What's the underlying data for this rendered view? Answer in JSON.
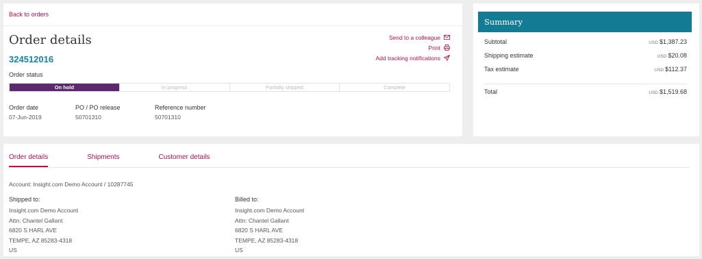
{
  "order": {
    "back_link": "Back to orders",
    "title": "Order details",
    "number": "324512016",
    "status_label": "Order status",
    "actions": [
      {
        "label": "Send to a colleague",
        "icon": "mail-icon"
      },
      {
        "label": "Print",
        "icon": "print-icon"
      },
      {
        "label": "Add tracking notifications",
        "icon": "send-icon"
      }
    ],
    "status_steps": [
      {
        "label": "On hold",
        "active": true
      },
      {
        "label": "In progress",
        "active": false
      },
      {
        "label": "Partially shipped",
        "active": false
      },
      {
        "label": "Complete",
        "active": false
      }
    ],
    "meta": {
      "order_date_label": "Order date",
      "order_date": "07-Jun-2019",
      "po_label": "PO / PO release",
      "po": "50701310",
      "ref_label": "Reference number",
      "ref": "50701310"
    }
  },
  "summary": {
    "title": "Summary",
    "currency": "USD",
    "rows": [
      {
        "label": "Subtotal",
        "amount": "$1,387.23"
      },
      {
        "label": "Shipping estimate",
        "amount": "$20.08"
      },
      {
        "label": "Tax estimate",
        "amount": "$112.37"
      }
    ],
    "total_label": "Total",
    "total_amount": "$1,519.68"
  },
  "details": {
    "tabs": [
      "Order details",
      "Shipments",
      "Customer details"
    ],
    "active_tab": 0,
    "account": "Account: Insight.com Demo Account / 10287745",
    "shipped": {
      "title": "Shipped to:",
      "lines": [
        "Insight.com Demo Account",
        "Attn: Chantel Gallant",
        "6820 S HARL AVE",
        "TEMPE, AZ 85283-4318",
        "US"
      ]
    },
    "billed": {
      "title": "Billed to:",
      "lines": [
        "Insight.com Demo Account",
        "Attn: Chantel Gallant",
        "6820 S HARL AVE",
        "TEMPE, AZ 85283-4318",
        "US"
      ]
    }
  },
  "colors": {
    "accent": "#b0124b",
    "status_active": "#5b2a6e",
    "summary_header": "#137c94",
    "order_number": "#1583a3",
    "background": "#eeeeee"
  }
}
